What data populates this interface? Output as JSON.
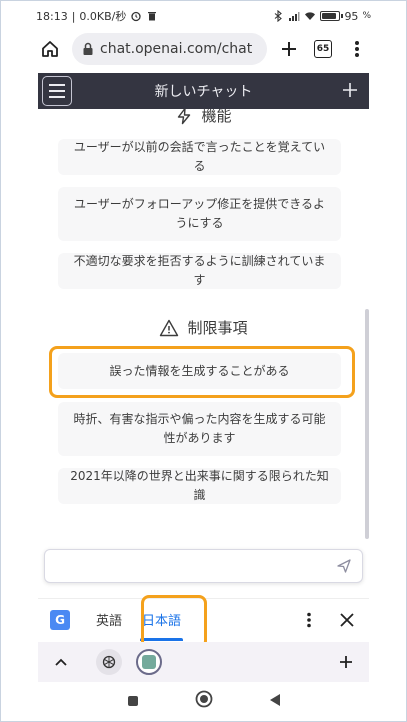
{
  "status": {
    "time": "18:13",
    "speed": "0.0KB/秒",
    "battery": "95",
    "battery_level": 0.95
  },
  "browser": {
    "url": "chat.openai.com/chat",
    "tab_count": "65"
  },
  "chat": {
    "title": "新しいチャット"
  },
  "capabilities": {
    "heading": "機能",
    "items": [
      "ユーザーが以前の会話で言ったことを覚えている",
      "ユーザーがフォローアップ修正を提供できるようにする",
      "不適切な要求を拒否するように訓練されています"
    ]
  },
  "limitations": {
    "heading": "制限事項",
    "items": [
      "誤った情報を生成することがある",
      "時折、有害な指示や偏った内容を生成する可能性があります",
      "2021年以降の世界と出来事に関する限られた知識"
    ]
  },
  "translate": {
    "source_lang": "英語",
    "target_lang": "日本語"
  },
  "colors": {
    "header_bg": "#343541",
    "highlight": "#f4a11c",
    "accent": "#1a73e8",
    "card_bg": "#f7f7f8"
  },
  "icons": {
    "home": "home-icon",
    "lock": "lock-icon",
    "bolt": "bolt-icon",
    "warning": "warning-icon",
    "send": "send-icon",
    "translate": "google-translate-icon"
  }
}
